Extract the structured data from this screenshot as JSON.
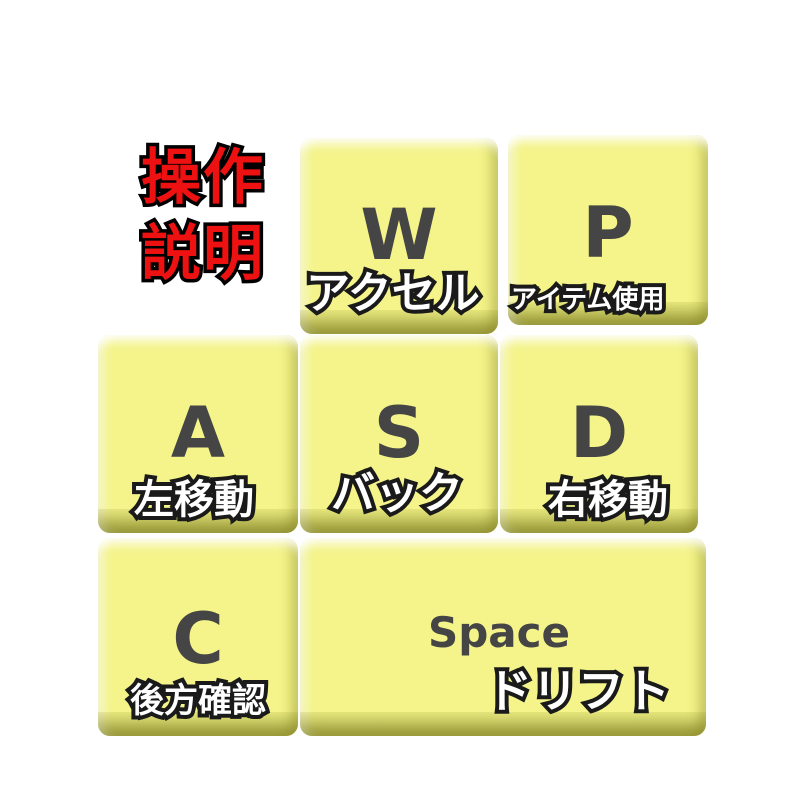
{
  "title": {
    "line1": "操作",
    "line2": "説明"
  },
  "keys": {
    "w": {
      "letter": "W",
      "label": "アクセル"
    },
    "p": {
      "letter": "P",
      "label": "アイテム使用"
    },
    "a": {
      "letter": "A",
      "label": "左移動"
    },
    "s": {
      "letter": "S",
      "label": "バック"
    },
    "d": {
      "letter": "D",
      "label": "右移動"
    },
    "c": {
      "letter": "C",
      "label": "後方確認"
    },
    "space": {
      "letter": "Space",
      "label": "ドリフト"
    }
  },
  "colors": {
    "key_face": "#f4f48a",
    "key_letter": "#454545",
    "title_red": "#ee1111",
    "outline": "#1a1a1a"
  }
}
